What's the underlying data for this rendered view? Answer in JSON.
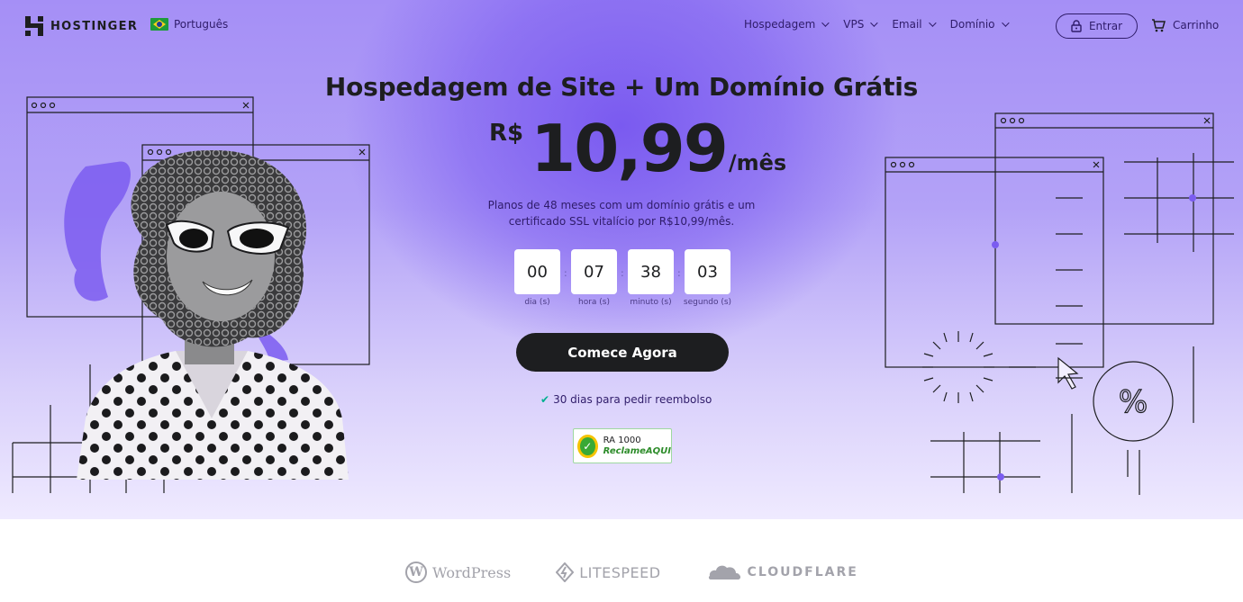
{
  "brand": {
    "name": "HOSTINGER"
  },
  "language": {
    "label": "Português"
  },
  "nav": {
    "items": [
      {
        "label": "Hospedagem"
      },
      {
        "label": "VPS"
      },
      {
        "label": "Email"
      },
      {
        "label": "Domínio"
      }
    ],
    "login_label": "Entrar",
    "cart_label": "Carrinho"
  },
  "hero": {
    "headline": "Hospedagem de Site + Um Domínio Grátis",
    "currency": "R$",
    "price": "10,99",
    "period": "/mês",
    "description": "Planos de 48 meses com um domínio grátis e um certificado SSL vitalício por R$10,99/mês.",
    "countdown": [
      {
        "value": "00",
        "label": "dia (s)"
      },
      {
        "value": "07",
        "label": "hora (s)"
      },
      {
        "value": "38",
        "label": "minuto (s)"
      },
      {
        "value": "03",
        "label": "segundo (s)"
      }
    ],
    "cta_label": "Comece Agora",
    "refund_text": "30 dias para pedir reembolso",
    "badge": {
      "line1": "RA 1000",
      "line2": "ReclameAQUI"
    }
  },
  "partners": [
    {
      "name": "WordPress"
    },
    {
      "name": "LITESPEED"
    },
    {
      "name": "CLOUDFLARE"
    }
  ],
  "colors": {
    "hero_purple": "#7a5af0",
    "text_dark": "#1d1e20",
    "nav_text": "#2f1c6a",
    "check_green": "#00b090"
  }
}
